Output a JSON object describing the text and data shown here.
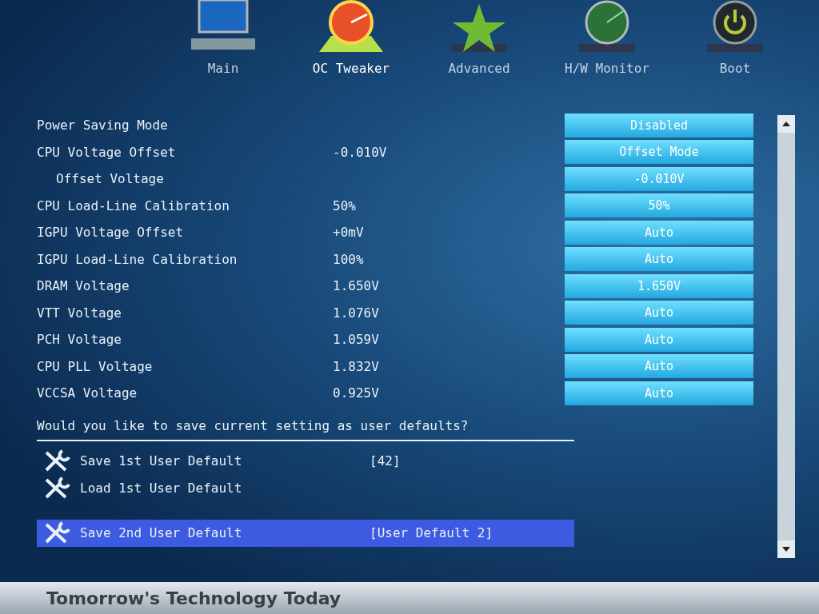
{
  "tabs": [
    {
      "label": "Main",
      "kind": "logo",
      "selected": false
    },
    {
      "label": "OC Tweaker",
      "kind": "gauge",
      "selected": true
    },
    {
      "label": "Advanced",
      "kind": "star",
      "selected": false
    },
    {
      "label": "H/W Monitor",
      "kind": "radar",
      "selected": false
    },
    {
      "label": "Boot",
      "kind": "power",
      "selected": false
    }
  ],
  "settings": [
    {
      "label": "Power Saving Mode",
      "option": "Disabled"
    },
    {
      "label": "CPU Voltage Offset",
      "value": "-0.010V",
      "option": "Offset Mode",
      "children": [
        {
          "label": "Offset Voltage",
          "option": "-0.010V"
        }
      ]
    },
    {
      "label": "CPU Load-Line Calibration",
      "value": "50%",
      "option": "50%"
    },
    {
      "label": "IGPU Voltage Offset",
      "value": "+0mV",
      "option": "Auto"
    },
    {
      "label": "IGPU Load-Line Calibration",
      "value": "100%",
      "option": "Auto"
    },
    {
      "label": "DRAM Voltage",
      "value": "1.650V",
      "option": "1.650V"
    },
    {
      "label": "VTT Voltage",
      "value": "1.076V",
      "option": "Auto"
    },
    {
      "label": "PCH Voltage",
      "value": "1.059V",
      "option": "Auto"
    },
    {
      "label": "CPU PLL Voltage",
      "value": "1.832V",
      "option": "Auto"
    },
    {
      "label": "VCCSA Voltage",
      "value": "0.925V",
      "option": "Auto"
    }
  ],
  "question": "Would you like to save current setting as user defaults?",
  "user_defaults": [
    {
      "label": "Save 1st User Default",
      "value": "[42]",
      "selected": false
    },
    {
      "label": "Load 1st User Default",
      "selected": false
    },
    {
      "label": "Save 2nd User Default",
      "value": "[User Default 2]",
      "selected": true
    }
  ],
  "footer": "Tomorrow's Technology Today"
}
